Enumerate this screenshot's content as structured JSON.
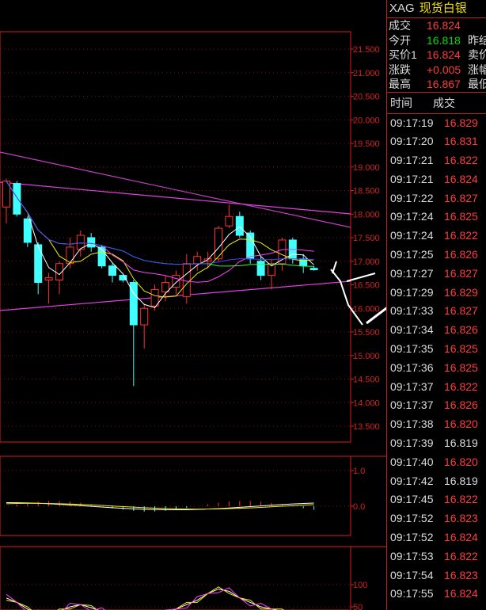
{
  "header": {
    "symbol": "XAG",
    "name": "现货白银"
  },
  "quote": [
    {
      "label": "成交",
      "value": "16.824",
      "color": "red",
      "label2": ""
    },
    {
      "label": "今开",
      "value": "16.818",
      "color": "green",
      "label2": "昨结"
    },
    {
      "label": "买价1",
      "value": "16.824",
      "color": "red",
      "label2": "卖价"
    },
    {
      "label": "涨跌",
      "value": "+0.005",
      "color": "red",
      "label2": "涨幅"
    },
    {
      "label": "最高",
      "value": "16.867",
      "color": "red",
      "label2": "最低"
    }
  ],
  "ticks_header": {
    "time": "时间",
    "price": "成交"
  },
  "ticks": [
    {
      "time": "09:17:19",
      "price": "16.829",
      "color": "red"
    },
    {
      "time": "09:17:20",
      "price": "16.831",
      "color": "red"
    },
    {
      "time": "09:17:21",
      "price": "16.822",
      "color": "red"
    },
    {
      "time": "09:17:21",
      "price": "16.824",
      "color": "red"
    },
    {
      "time": "09:17:22",
      "price": "16.827",
      "color": "red"
    },
    {
      "time": "09:17:24",
      "price": "16.825",
      "color": "red"
    },
    {
      "time": "09:17:24",
      "price": "16.822",
      "color": "red"
    },
    {
      "time": "09:17:25",
      "price": "16.826",
      "color": "red"
    },
    {
      "time": "09:17:27",
      "price": "16.827",
      "color": "red"
    },
    {
      "time": "09:17:29",
      "price": "16.829",
      "color": "red"
    },
    {
      "time": "09:17:33",
      "price": "16.827",
      "color": "red"
    },
    {
      "time": "09:17:34",
      "price": "16.826",
      "color": "red"
    },
    {
      "time": "09:17:35",
      "price": "16.825",
      "color": "red"
    },
    {
      "time": "09:17:36",
      "price": "16.825",
      "color": "red"
    },
    {
      "time": "09:17:37",
      "price": "16.822",
      "color": "red"
    },
    {
      "time": "09:17:37",
      "price": "16.826",
      "color": "red"
    },
    {
      "time": "09:17:38",
      "price": "16.820",
      "color": "red"
    },
    {
      "time": "09:17:39",
      "price": "16.819",
      "color": "white"
    },
    {
      "time": "09:17:40",
      "price": "16.820",
      "color": "red"
    },
    {
      "time": "09:17:42",
      "price": "16.819",
      "color": "white"
    },
    {
      "time": "09:17:45",
      "price": "16.822",
      "color": "red"
    },
    {
      "time": "09:17:52",
      "price": "16.823",
      "color": "red"
    },
    {
      "time": "09:17:52",
      "price": "16.824",
      "color": "red"
    },
    {
      "time": "09:17:53",
      "price": "16.822",
      "color": "red"
    },
    {
      "time": "09:17:54",
      "price": "16.823",
      "color": "red"
    },
    {
      "time": "09:17:55",
      "price": "16.824",
      "color": "red"
    }
  ],
  "chart_data": [
    {
      "type": "candlestick",
      "ylim": [
        13.2,
        21.7
      ],
      "ytick_labels": [
        "21.500",
        "21.000",
        "20.500",
        "20.000",
        "19.500",
        "19.000",
        "18.500",
        "18.000",
        "17.500",
        "17.000",
        "16.500",
        "16.000",
        "15.500",
        "15.000",
        "14.500",
        "14.000",
        "13.500"
      ],
      "candles": [
        {
          "o": 18.15,
          "h": 18.75,
          "l": 17.8,
          "c": 18.7,
          "up": true
        },
        {
          "o": 18.65,
          "h": 18.7,
          "l": 17.95,
          "c": 18.0,
          "up": false
        },
        {
          "o": 17.9,
          "h": 17.95,
          "l": 17.3,
          "c": 17.4,
          "up": false
        },
        {
          "o": 17.35,
          "h": 17.4,
          "l": 16.3,
          "c": 16.55,
          "up": false
        },
        {
          "o": 16.6,
          "h": 16.75,
          "l": 16.1,
          "c": 16.65,
          "up": true
        },
        {
          "o": 16.6,
          "h": 17.0,
          "l": 16.3,
          "c": 16.95,
          "up": true
        },
        {
          "o": 16.95,
          "h": 17.5,
          "l": 16.85,
          "c": 17.3,
          "up": true
        },
        {
          "o": 17.25,
          "h": 17.65,
          "l": 17.1,
          "c": 17.55,
          "up": true
        },
        {
          "o": 17.5,
          "h": 17.6,
          "l": 17.2,
          "c": 17.3,
          "up": false
        },
        {
          "o": 17.3,
          "h": 17.35,
          "l": 16.85,
          "c": 16.9,
          "up": false
        },
        {
          "o": 16.9,
          "h": 16.95,
          "l": 16.55,
          "c": 16.7,
          "up": false
        },
        {
          "o": 16.7,
          "h": 16.75,
          "l": 16.55,
          "c": 16.6,
          "up": false
        },
        {
          "o": 16.55,
          "h": 16.6,
          "l": 14.35,
          "c": 15.65,
          "up": false
        },
        {
          "o": 15.65,
          "h": 16.1,
          "l": 15.15,
          "c": 16.0,
          "up": true
        },
        {
          "o": 16.05,
          "h": 16.5,
          "l": 15.95,
          "c": 16.4,
          "up": true
        },
        {
          "o": 16.35,
          "h": 16.7,
          "l": 16.15,
          "c": 16.55,
          "up": true
        },
        {
          "o": 16.45,
          "h": 16.8,
          "l": 16.3,
          "c": 16.7,
          "up": true
        },
        {
          "o": 16.25,
          "h": 17.15,
          "l": 16.1,
          "c": 16.95,
          "up": true
        },
        {
          "o": 16.95,
          "h": 17.2,
          "l": 16.8,
          "c": 17.1,
          "up": true
        },
        {
          "o": 17.0,
          "h": 17.2,
          "l": 16.85,
          "c": 17.05,
          "up": true
        },
        {
          "o": 17.05,
          "h": 17.75,
          "l": 17.0,
          "c": 17.7,
          "up": true
        },
        {
          "o": 17.75,
          "h": 18.2,
          "l": 17.7,
          "c": 17.95,
          "up": true
        },
        {
          "o": 17.95,
          "h": 18.05,
          "l": 17.5,
          "c": 17.55,
          "up": false
        },
        {
          "o": 17.6,
          "h": 17.65,
          "l": 16.95,
          "c": 17.05,
          "up": false
        },
        {
          "o": 17.0,
          "h": 17.1,
          "l": 16.6,
          "c": 16.7,
          "up": false
        },
        {
          "o": 16.7,
          "h": 17.05,
          "l": 16.4,
          "c": 16.95,
          "up": true
        },
        {
          "o": 16.95,
          "h": 17.5,
          "l": 16.8,
          "c": 17.45,
          "up": true
        },
        {
          "o": 17.45,
          "h": 17.5,
          "l": 16.95,
          "c": 17.05,
          "up": false
        },
        {
          "o": 17.05,
          "h": 17.15,
          "l": 16.75,
          "c": 16.9,
          "up": false
        },
        {
          "o": 16.85,
          "h": 16.9,
          "l": 16.8,
          "c": 16.82,
          "up": false
        }
      ]
    },
    {
      "type": "bar",
      "ylim": [
        -0.6,
        1.3
      ],
      "ytick_labels": [
        "1.0",
        "0.0"
      ]
    },
    {
      "type": "line",
      "ylim": [
        -10,
        115
      ],
      "ytick_labels": [
        "100",
        "50"
      ]
    }
  ]
}
